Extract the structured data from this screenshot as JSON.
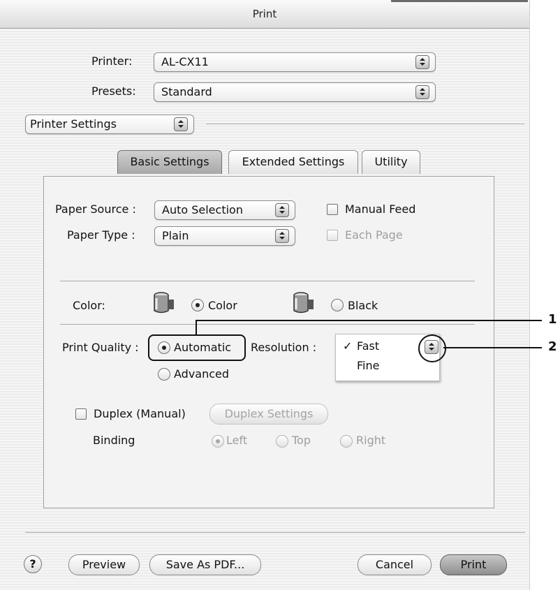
{
  "window": {
    "title": "Print"
  },
  "printer": {
    "label": "Printer:",
    "value": "AL-CX11"
  },
  "presets": {
    "label": "Presets:",
    "value": "Standard"
  },
  "section": {
    "value": "Printer Settings"
  },
  "tabs": [
    {
      "label": "Basic Settings",
      "active": true
    },
    {
      "label": "Extended Settings",
      "active": false
    },
    {
      "label": "Utility",
      "active": false
    }
  ],
  "paper_source": {
    "label": "Paper Source :",
    "value": "Auto Selection"
  },
  "paper_type": {
    "label": "Paper Type :",
    "value": "Plain"
  },
  "manual_feed": {
    "label": "Manual Feed"
  },
  "each_page": {
    "label": "Each Page"
  },
  "color": {
    "label": "Color:",
    "option_color": "Color",
    "option_black": "Black"
  },
  "print_quality": {
    "label": "Print Quality :",
    "automatic": "Automatic",
    "advanced": "Advanced"
  },
  "resolution": {
    "label": "Resolution :",
    "options": [
      "Fast",
      "Fine"
    ],
    "check_mark": "✓"
  },
  "duplex": {
    "checkbox_label": "Duplex (Manual)",
    "settings_button": "Duplex Settings",
    "binding_label": "Binding",
    "left": "Left",
    "top": "Top",
    "right": "Right"
  },
  "buttons": {
    "help": "?",
    "preview": "Preview",
    "save_pdf": "Save As PDF...",
    "cancel": "Cancel",
    "print": "Print"
  },
  "callouts": {
    "one": "1",
    "two": "2"
  }
}
